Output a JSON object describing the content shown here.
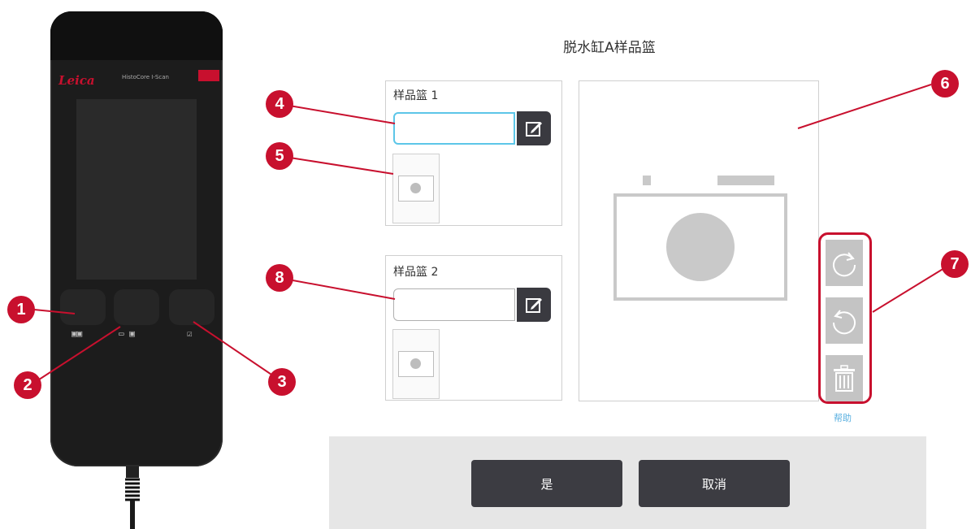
{
  "dialog": {
    "title": "脱水缸A样品篮",
    "basket1": {
      "label": "样品篮 1",
      "value": ""
    },
    "basket2": {
      "label": "样品篮 2",
      "value": ""
    },
    "help": "帮助",
    "ok_button": "是",
    "cancel_button": "取消"
  },
  "scanner": {
    "brand": "Leica",
    "model": "HistoCore I-Scan",
    "cable_icon": "cable-icon",
    "key_icons": [
      "scan-barcode-icon",
      "photo-scan-icon",
      "confirm-icon"
    ]
  },
  "callouts": [
    "1",
    "2",
    "3",
    "4",
    "5",
    "6",
    "7",
    "8"
  ],
  "tools": [
    "rotate-clockwise-icon",
    "rotate-counterclockwise-icon",
    "trash-icon"
  ],
  "colors": {
    "accent_red": "#c8102e",
    "input_focus": "#5cc6e8",
    "button_dark": "#3c3c42",
    "tool_gray": "#c4c4c4",
    "help_link": "#5ab0e0"
  }
}
